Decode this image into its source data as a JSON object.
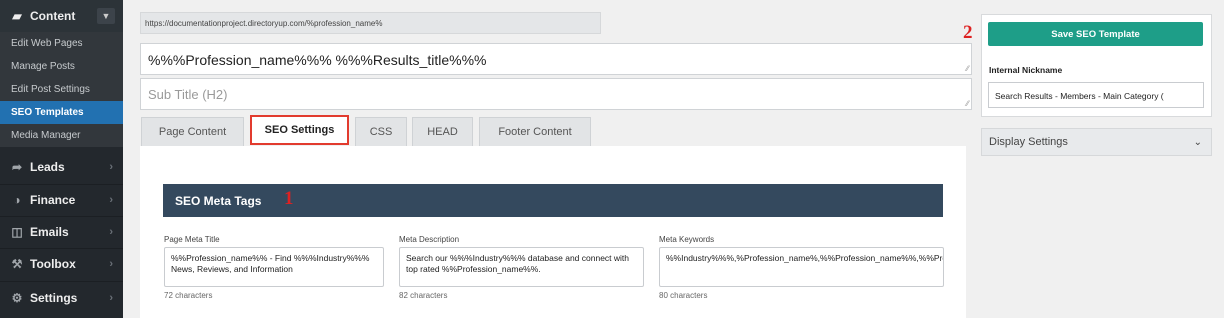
{
  "sidebar": {
    "content_label": "Content",
    "sub_items": [
      "Edit Web Pages",
      "Manage Posts",
      "Edit Post Settings",
      "SEO Templates",
      "Media Manager"
    ],
    "active_item": "SEO Templates",
    "sections": [
      "Leads",
      "Finance",
      "Emails",
      "Toolbox",
      "Settings"
    ]
  },
  "editor": {
    "url": "https://documentationproject.directoryup.com/%profession_name%",
    "title_value": "%%%Profession_name%%% %%%Results_title%%%",
    "subtitle_placeholder": "Sub Title (H2)"
  },
  "tabs": [
    "Page Content",
    "SEO Settings",
    "CSS",
    "HEAD",
    "Footer Content"
  ],
  "active_tab": "SEO Settings",
  "seo": {
    "header": "SEO Meta Tags",
    "fields": [
      {
        "label": "Page Meta Title",
        "value": "%%Profession_name%% - Find %%%Industry%%% News, Reviews, and Information",
        "count": "72 characters"
      },
      {
        "label": "Meta Description",
        "value": "Search our %%%Industry%%% database and connect with top rated %%Profession_name%%.",
        "count": "82 characters"
      },
      {
        "label": "Meta Keywords",
        "value": "%%Industry%%%,%Profession_name%,%%Profession_name%%,%%Profession%,%%Profession%%",
        "count": "80 characters"
      }
    ]
  },
  "right_panel": {
    "save_button": "Save SEO Template",
    "nickname_label": "Internal Nickname",
    "nickname_value": "Search Results - Members - Main Category (",
    "display_settings": "Display Settings"
  },
  "markers": [
    "1",
    "2"
  ],
  "colors": {
    "sidebar": "#23282d",
    "active": "#2271b1",
    "save_button": "#1e9e88",
    "header": "#34495e",
    "highlight": "#e23b2e"
  }
}
